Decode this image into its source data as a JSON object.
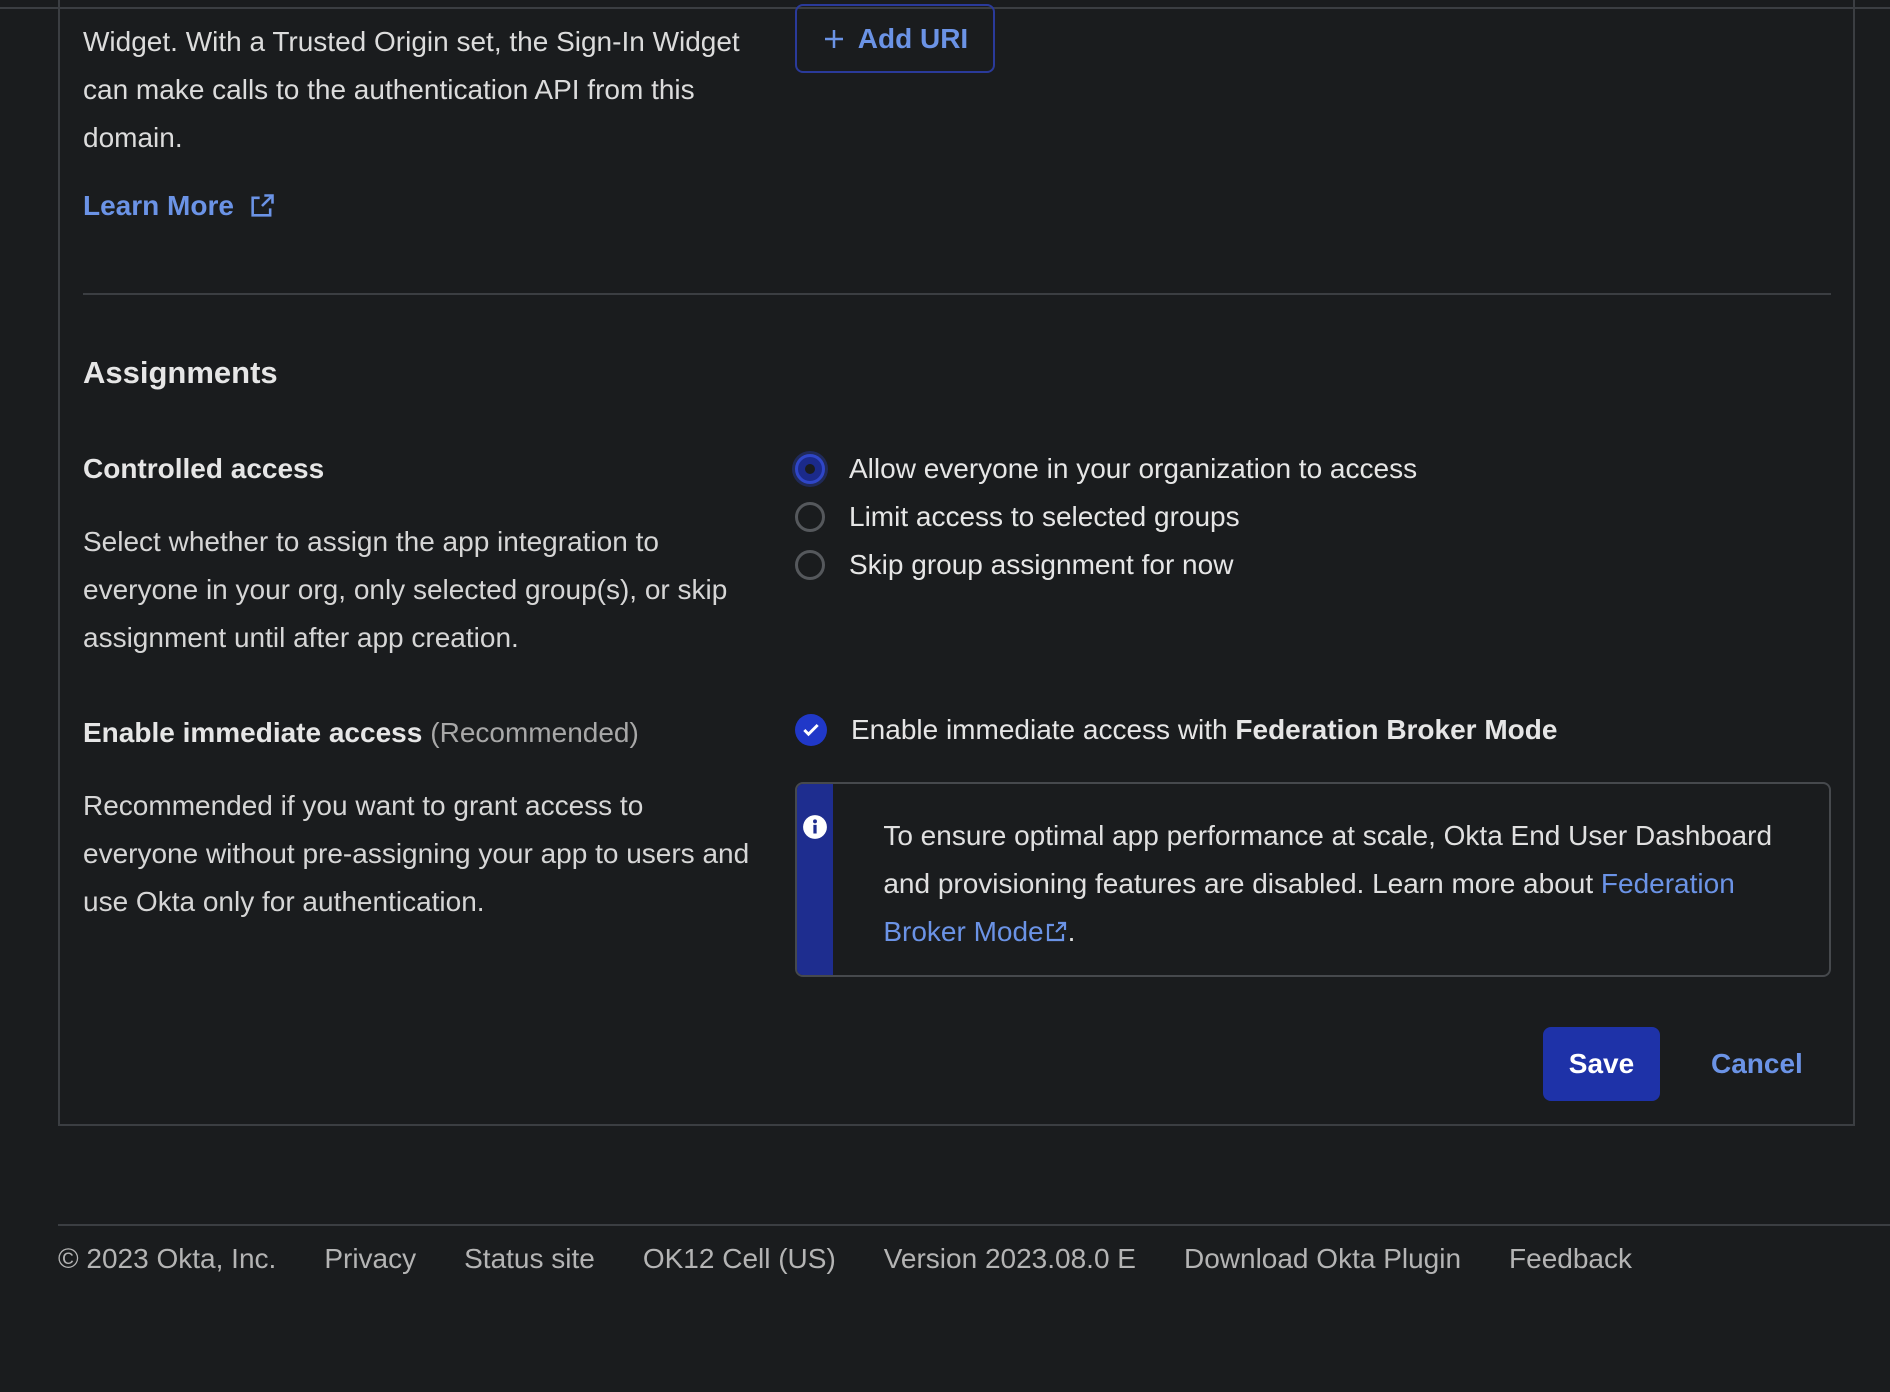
{
  "trusted_origin": {
    "description": "Widget. With a Trusted Origin set, the Sign-In Widget can make calls to the authentication API from this domain.",
    "learn_more": "Learn More",
    "add_uri_label": "Add URI"
  },
  "assignments": {
    "title": "Assignments",
    "controlled_access": {
      "label": "Controlled access",
      "description": "Select whether to assign the app integration to everyone in your org, only selected group(s), or skip assignment until after app creation.",
      "options": [
        {
          "label": "Allow everyone in your organization to access",
          "selected": true
        },
        {
          "label": "Limit access to selected groups",
          "selected": false
        },
        {
          "label": "Skip group assignment for now",
          "selected": false
        }
      ]
    },
    "immediate_access": {
      "label": "Enable immediate access",
      "recommended": "(Recommended)",
      "description": "Recommended if you want to grant access to everyone without pre-assigning your app to users and use Okta only for authentication.",
      "checkbox_prefix": "Enable immediate access with ",
      "checkbox_bold": "Federation Broker Mode",
      "checked": true,
      "callout_text": "To ensure optimal app performance at scale, Okta End User Dashboard and provisioning features are disabled. Learn more about ",
      "callout_link": "Federation Broker Mode",
      "callout_end": "."
    }
  },
  "actions": {
    "save": "Save",
    "cancel": "Cancel"
  },
  "footer": {
    "copyright": "© 2023 Okta, Inc.",
    "privacy": "Privacy",
    "status": "Status site",
    "cell": "OK12 Cell (US)",
    "version": "Version 2023.08.0 E",
    "plugin": "Download Okta Plugin",
    "feedback": "Feedback"
  },
  "colors": {
    "background": "#1a1c1e",
    "accent": "#1e32a8",
    "link": "#6b93e6"
  }
}
